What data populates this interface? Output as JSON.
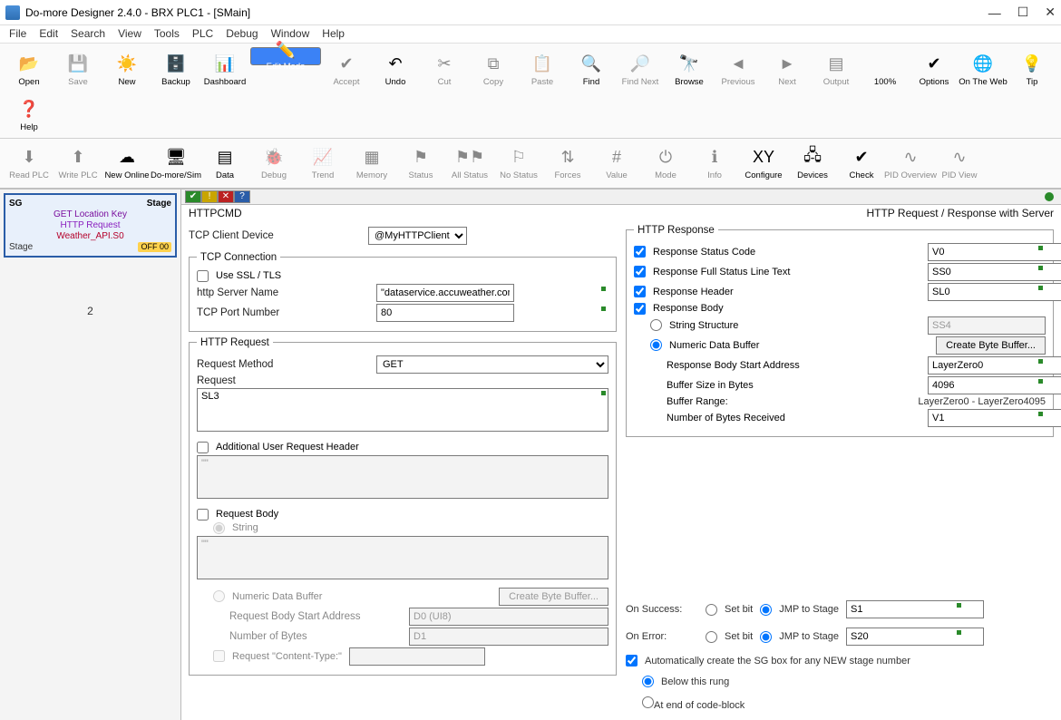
{
  "window": {
    "title": "Do-more Designer 2.4.0 - BRX PLC1 - [SMain]"
  },
  "menu": [
    "File",
    "Edit",
    "Search",
    "View",
    "Tools",
    "PLC",
    "Debug",
    "Window",
    "Help"
  ],
  "toolbar1": [
    {
      "label": "Open",
      "icon": "📂"
    },
    {
      "label": "Save",
      "icon": "💾",
      "dis": true
    },
    {
      "label": "New",
      "icon": "☀️"
    },
    {
      "label": "Backup",
      "icon": "🗄️"
    },
    {
      "label": "Dashboard",
      "icon": "📊"
    },
    {
      "label": "Edit Mode",
      "icon": "✏️",
      "sel": true
    },
    {
      "label": "Accept",
      "icon": "✔",
      "dis": true
    },
    {
      "label": "Undo",
      "icon": "↶"
    },
    {
      "label": "Cut",
      "icon": "✂",
      "dis": true
    },
    {
      "label": "Copy",
      "icon": "⧉",
      "dis": true
    },
    {
      "label": "Paste",
      "icon": "📋",
      "dis": true
    },
    {
      "label": "Find",
      "icon": "🔍"
    },
    {
      "label": "Find Next",
      "icon": "🔎",
      "dis": true
    },
    {
      "label": "Browse",
      "icon": "🔭"
    },
    {
      "label": "Previous",
      "icon": "◄",
      "dis": true
    },
    {
      "label": "Next",
      "icon": "►",
      "dis": true
    },
    {
      "label": "Output",
      "icon": "▤",
      "dis": true
    },
    {
      "label": "100%",
      "icon": "",
      "text": true
    },
    {
      "label": "Options",
      "icon": "✔"
    },
    {
      "label": "On The Web",
      "icon": "🌐"
    },
    {
      "label": "Tip",
      "icon": "💡"
    },
    {
      "label": "Help",
      "icon": "❓"
    }
  ],
  "toolbar2": [
    {
      "label": "Read PLC",
      "icon": "⬇",
      "dis": true
    },
    {
      "label": "Write PLC",
      "icon": "⬆",
      "dis": true
    },
    {
      "label": "New Online",
      "icon": "☁"
    },
    {
      "label": "Do-more/Sim",
      "icon": "🖥"
    },
    {
      "label": "Data",
      "icon": "▤"
    },
    {
      "label": "Debug",
      "icon": "🐞",
      "dis": true
    },
    {
      "label": "Trend",
      "icon": "📈",
      "dis": true
    },
    {
      "label": "Memory",
      "icon": "▦",
      "dis": true
    },
    {
      "label": "Status",
      "icon": "⚑",
      "dis": true
    },
    {
      "label": "All Status",
      "icon": "⚑⚑",
      "dis": true
    },
    {
      "label": "No Status",
      "icon": "⚐",
      "dis": true
    },
    {
      "label": "Forces",
      "icon": "⇅",
      "dis": true
    },
    {
      "label": "Value",
      "icon": "#",
      "dis": true
    },
    {
      "label": "Mode",
      "icon": "⏻",
      "dis": true
    },
    {
      "label": "Info",
      "icon": "ℹ",
      "dis": true
    },
    {
      "label": "Configure",
      "icon": "XY"
    },
    {
      "label": "Devices",
      "icon": "🖧"
    },
    {
      "label": "Check",
      "icon": "✔"
    },
    {
      "label": "PID Overview",
      "icon": "∿",
      "dis": true
    },
    {
      "label": "PID View",
      "icon": "∿",
      "dis": true
    }
  ],
  "stage": {
    "hdrL": "SG",
    "hdrR": "Stage",
    "line1": "GET Location Key",
    "line2": "HTTP Request",
    "line3": "Weather_API.S0",
    "footL": "Stage",
    "badge": "OFF 00"
  },
  "rung2": "2",
  "cmd": {
    "name": "HTTPCMD",
    "desc": "HTTP Request / Response with Server"
  },
  "tcpDeviceLabel": "TCP Client Device",
  "tcpDevice": "@MyHTTPClient",
  "tcpConn": {
    "legend": "TCP Connection",
    "ssl": "Use SSL / TLS",
    "serverLabel": "http Server Name",
    "server": "\"dataservice.accuweather.com\"",
    "portLabel": "TCP Port Number",
    "port": "80"
  },
  "req": {
    "legend": "HTTP Request",
    "methodLabel": "Request Method",
    "method": "GET",
    "requestLabel": "Request",
    "request": "SL3",
    "addlHdr": "Additional User Request Header",
    "bodyLabel": "Request Body",
    "stringOpt": "String",
    "numOpt": "Numeric Data Buffer",
    "createBtn": "Create Byte Buffer...",
    "startAddr": "Request Body Start Address",
    "startAddrVal": "D0 (UI8)",
    "numBytes": "Number of Bytes",
    "numBytesVal": "D1",
    "contentType": "Request \"Content-Type:\""
  },
  "resp": {
    "legend": "HTTP Response",
    "statusCode": "Response Status Code",
    "statusCodeVal": "V0",
    "statusLine": "Response Full Status Line Text",
    "statusLineVal": "SS0",
    "header": "Response Header",
    "headerVal": "SL0",
    "body": "Response Body",
    "stringStruct": "String Structure",
    "stringStructVal": "SS4",
    "numBuf": "Numeric Data Buffer",
    "createBtn": "Create Byte Buffer...",
    "startAddr": "Response Body Start Address",
    "startAddrVal": "LayerZero0",
    "bufSize": "Buffer Size in Bytes",
    "bufSizeVal": "4096",
    "bufRange": "Buffer Range:",
    "bufRangeVal": "LayerZero0 - LayerZero4095",
    "bytesRecv": "Number of Bytes Received",
    "bytesRecvVal": "V1"
  },
  "onSuccess": {
    "label": "On Success:",
    "setbit": "Set bit",
    "jmp": "JMP to Stage",
    "val": "S1"
  },
  "onError": {
    "label": "On Error:",
    "setbit": "Set bit",
    "jmp": "JMP to Stage",
    "val": "S20"
  },
  "auto": {
    "chk": "Automatically create the SG box for any NEW stage number",
    "below": "Below this rung",
    "end": "At end of code-block"
  }
}
